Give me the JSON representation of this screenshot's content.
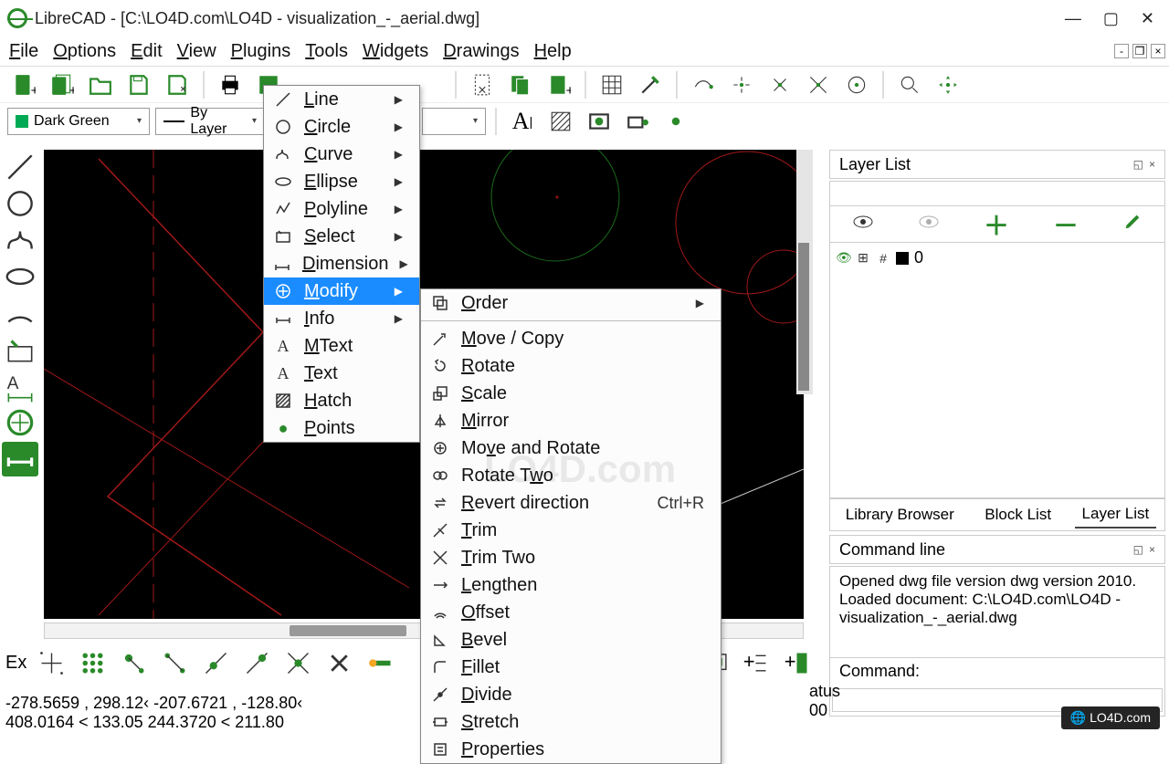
{
  "window": {
    "title": "LibreCAD - [C:\\LO4D.com\\LO4D - visualization_-_aerial.dwg]"
  },
  "menubar": {
    "file": "File",
    "options": "Options",
    "edit": "Edit",
    "view": "View",
    "plugins": "Plugins",
    "tools": "Tools",
    "widgets": "Widgets",
    "drawings": "Drawings",
    "help": "Help"
  },
  "combos": {
    "color": "Dark Green",
    "layer": "By Layer"
  },
  "tools_menu": {
    "items": [
      {
        "label": "Line",
        "ul": "L",
        "arrow": true
      },
      {
        "label": "Circle",
        "ul": "C",
        "arrow": true
      },
      {
        "label": "Curve",
        "ul": "C",
        "arrow": true
      },
      {
        "label": "Ellipse",
        "ul": "E",
        "arrow": true
      },
      {
        "label": "Polyline",
        "ul": "P",
        "arrow": true
      },
      {
        "label": "Select",
        "ul": "S",
        "arrow": true
      },
      {
        "label": "Dimension",
        "ul": "D",
        "arrow": true
      },
      {
        "label": "Modify",
        "ul": "M",
        "arrow": true,
        "highlight": true
      },
      {
        "label": "Info",
        "ul": "I",
        "arrow": true
      },
      {
        "label": "MText",
        "ul": "M"
      },
      {
        "label": "Text",
        "ul": "T"
      },
      {
        "label": "Hatch",
        "ul": "H"
      },
      {
        "label": "Points",
        "ul": "P"
      }
    ]
  },
  "modify_menu": {
    "items": [
      {
        "label": "Order",
        "ul": "O",
        "arrow": true,
        "sep_after": true
      },
      {
        "label": "Move / Copy",
        "ul": "M"
      },
      {
        "label": "Rotate",
        "ul": "R"
      },
      {
        "label": "Scale",
        "ul": "S"
      },
      {
        "label": "Mirror",
        "ul": "M"
      },
      {
        "label": "Move and Rotate",
        "ul": "v"
      },
      {
        "label": "Rotate Two",
        "ul": "w"
      },
      {
        "label": "Revert direction",
        "ul": "R",
        "shortcut": "Ctrl+R"
      },
      {
        "label": "Trim",
        "ul": "T"
      },
      {
        "label": "Trim Two",
        "ul": "T"
      },
      {
        "label": "Lengthen",
        "ul": "L"
      },
      {
        "label": "Offset",
        "ul": "O"
      },
      {
        "label": "Bevel",
        "ul": "B"
      },
      {
        "label": "Fillet",
        "ul": "F"
      },
      {
        "label": "Divide",
        "ul": "D"
      },
      {
        "label": "Stretch",
        "ul": "S"
      },
      {
        "label": "Properties",
        "ul": "P"
      }
    ]
  },
  "layer_panel": {
    "title": "Layer List",
    "row": {
      "name": "0"
    },
    "tabs": {
      "library": "Library Browser",
      "block": "Block List",
      "layer": "Layer List"
    }
  },
  "command_panel": {
    "title": "Command line",
    "log": "Opened dwg file version dwg version 2010.\nLoaded document: C:\\LO4D.com\\LO4D - visualization_-_aerial.dwg",
    "prompt": "Command:"
  },
  "bottom_toolbar": {
    "ex": "Ex"
  },
  "status": {
    "coords1": "-278.5659 , 298.12‹ -207.6721 , -128.80‹",
    "coords2": "408.0164 < 133.05 244.3720 < 211.80",
    "right1": "atus",
    "right2": "00"
  },
  "watermark": "LO4D.com",
  "watermark_badge": "🌐 LO4D.com"
}
